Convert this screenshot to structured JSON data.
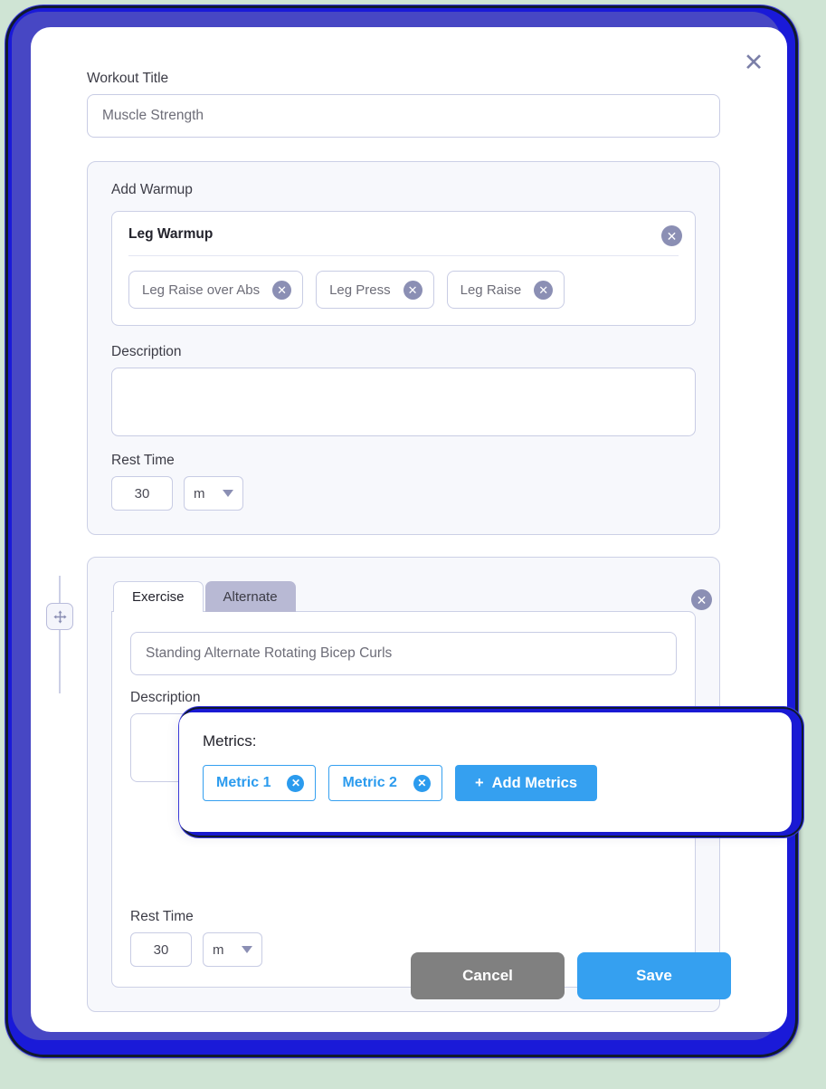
{
  "dialog": {
    "close_icon": "close-icon",
    "workout_title_label": "Workout Title",
    "workout_title_value": "Muscle Strength"
  },
  "warmup": {
    "section_label": "Add Warmup",
    "card_title": "Leg Warmup",
    "card_close_icon": "close-circle-icon",
    "chips": [
      {
        "label": "Leg Raise over Abs",
        "remove_icon": "close-circle-icon"
      },
      {
        "label": "Leg Press",
        "remove_icon": "close-circle-icon"
      },
      {
        "label": "Leg Raise",
        "remove_icon": "close-circle-icon"
      }
    ],
    "description_label": "Description",
    "description_value": "",
    "rest_time_label": "Rest Time",
    "rest_time_value": "30",
    "rest_time_unit": "m"
  },
  "exercise": {
    "drag_handle_icon": "move-arrows-icon",
    "card_close_icon": "close-circle-icon",
    "tabs": [
      {
        "label": "Exercise",
        "active": true
      },
      {
        "label": "Alternate",
        "active": false
      }
    ],
    "name_value": "Standing Alternate Rotating Bicep Curls",
    "description_label": "Description",
    "description_value": "",
    "rest_time_label": "Rest Time",
    "rest_time_value": "30",
    "rest_time_unit": "m"
  },
  "metrics": {
    "label": "Metrics:",
    "chips": [
      {
        "label": "Metric 1",
        "remove_icon": "close-circle-icon"
      },
      {
        "label": "Metric 2",
        "remove_icon": "close-circle-icon"
      }
    ],
    "add_button_label": "Add Metrics",
    "add_button_plus": "+"
  },
  "footer": {
    "cancel_label": "Cancel",
    "save_label": "Save"
  },
  "colors": {
    "frame_blue": "#1a1ad8",
    "accent_blue": "#35a0f0",
    "cancel_gray": "#808080",
    "panel_bg": "#f7f8fc",
    "chip_border": "#c8cce4",
    "tab_inactive": "#b8b9d4",
    "page_bg": "#cfe4d4"
  }
}
